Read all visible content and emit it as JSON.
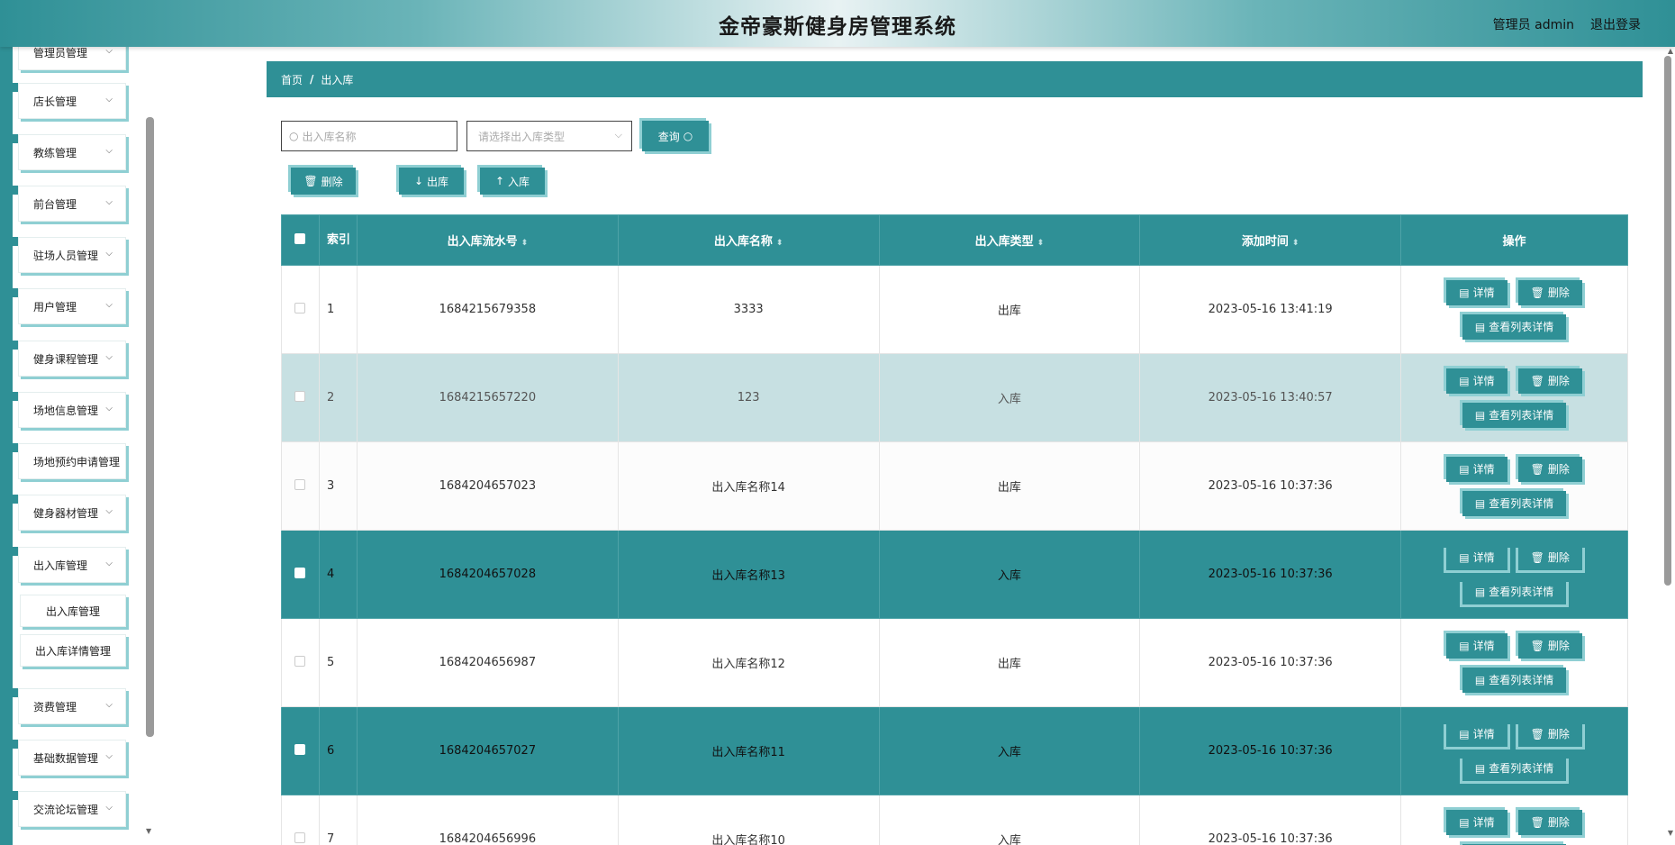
{
  "header": {
    "title": "金帝豪斯健身房管理系统",
    "user": "管理员 admin",
    "logout": "退出登录"
  },
  "sidebar": {
    "items": [
      {
        "label": "管理员管理"
      },
      {
        "label": "店长管理"
      },
      {
        "label": "教练管理"
      },
      {
        "label": "前台管理"
      },
      {
        "label": "驻场人员管理"
      },
      {
        "label": "用户管理"
      },
      {
        "label": "健身课程管理"
      },
      {
        "label": "场地信息管理"
      },
      {
        "label": "场地预约申请管理"
      },
      {
        "label": "健身器材管理"
      },
      {
        "label": "出入库管理"
      },
      {
        "label": "资费管理"
      },
      {
        "label": "基础数据管理"
      },
      {
        "label": "交流论坛管理"
      }
    ],
    "subitems": [
      {
        "label": "出入库管理"
      },
      {
        "label": "出入库详情管理"
      }
    ]
  },
  "breadcrumb": {
    "home": "首页",
    "sep": "/",
    "current": "出入库"
  },
  "search": {
    "name_placeholder": "出入库名称",
    "type_placeholder": "请选择出入库类型",
    "query_label": "查询"
  },
  "actions": {
    "delete_label": "删除",
    "out_label": "出库",
    "in_label": "入库"
  },
  "table": {
    "headers": {
      "index": "索引",
      "serial": "出入库流水号",
      "name": "出入库名称",
      "type": "出入库类型",
      "time": "添加时间",
      "ops": "操作"
    },
    "op_labels": {
      "detail": "详情",
      "delete": "删除",
      "list_detail": "查看列表详情"
    },
    "rows": [
      {
        "index": "1",
        "serial": "1684215679358",
        "name": "3333",
        "type": "出库",
        "time": "2023-05-16 13:41:19"
      },
      {
        "index": "2",
        "serial": "1684215657220",
        "name": "123",
        "type": "入库",
        "time": "2023-05-16 13:40:57"
      },
      {
        "index": "3",
        "serial": "1684204657023",
        "name": "出入库名称14",
        "type": "出库",
        "time": "2023-05-16 10:37:36"
      },
      {
        "index": "4",
        "serial": "1684204657028",
        "name": "出入库名称13",
        "type": "入库",
        "time": "2023-05-16 10:37:36"
      },
      {
        "index": "5",
        "serial": "1684204656987",
        "name": "出入库名称12",
        "type": "出库",
        "time": "2023-05-16 10:37:36"
      },
      {
        "index": "6",
        "serial": "1684204657027",
        "name": "出入库名称11",
        "type": "入库",
        "time": "2023-05-16 10:37:36"
      },
      {
        "index": "7",
        "serial": "1684204656996",
        "name": "出入库名称10",
        "type": "入库",
        "time": "2023-05-16 10:37:36"
      }
    ]
  },
  "colors": {
    "primary": "#2f9096",
    "accent_shadow": "#8fcfd3",
    "highlight_row": "#c7e0e2"
  }
}
